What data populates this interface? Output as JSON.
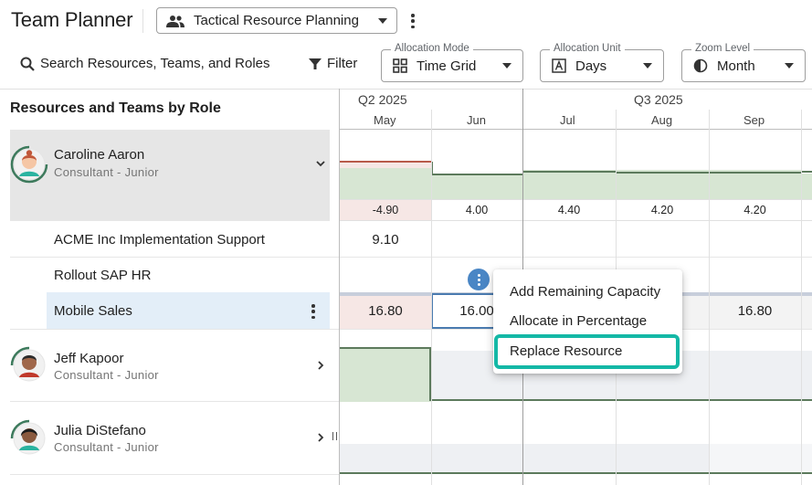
{
  "header": {
    "title": "Team Planner",
    "plan_name": "Tactical Resource Planning"
  },
  "toolbar": {
    "search_label": "Search Resources, Teams, and Roles",
    "filter_label": "Filter",
    "allocation_mode": {
      "legend": "Allocation Mode",
      "value": "Time Grid"
    },
    "allocation_unit": {
      "legend": "Allocation Unit",
      "value": "Days"
    },
    "zoom_level": {
      "legend": "Zoom Level",
      "value": "Month"
    }
  },
  "left_panel": {
    "title": "Resources and Teams by Role",
    "resources": [
      {
        "name": "Caroline Aaron",
        "role": "Consultant - Junior",
        "expanded": true
      },
      {
        "name": "Jeff Kapoor",
        "role": "Consultant - Junior",
        "expanded": false
      },
      {
        "name": "Julia DiStefano",
        "role": "Consultant - Junior",
        "expanded": false
      }
    ],
    "tasks": [
      {
        "label": "ACME Inc Implementation Support"
      },
      {
        "label": "Rollout SAP HR"
      },
      {
        "label": "Mobile Sales"
      }
    ]
  },
  "timeline": {
    "quarters": [
      "Q2 2025",
      "Q3 2025"
    ],
    "months": [
      "May",
      "Jun",
      "Jul",
      "Aug",
      "Sep"
    ],
    "caroline_remaining": [
      "-4.90",
      "4.00",
      "4.40",
      "4.20",
      "4.20"
    ],
    "acme_values": [
      "9.10"
    ],
    "mobile_sales_values": [
      "16.80",
      "16.00",
      "16.80"
    ]
  },
  "context_menu": {
    "items": [
      "Add Remaining Capacity",
      "Allocate in Percentage",
      "Replace Resource"
    ]
  },
  "colors": {
    "accent_highlight": "#14b8a6",
    "over_allocation": "#f6e7e5",
    "allocation_green": "#d7e6d3",
    "selection_blue": "#e3eef8"
  }
}
